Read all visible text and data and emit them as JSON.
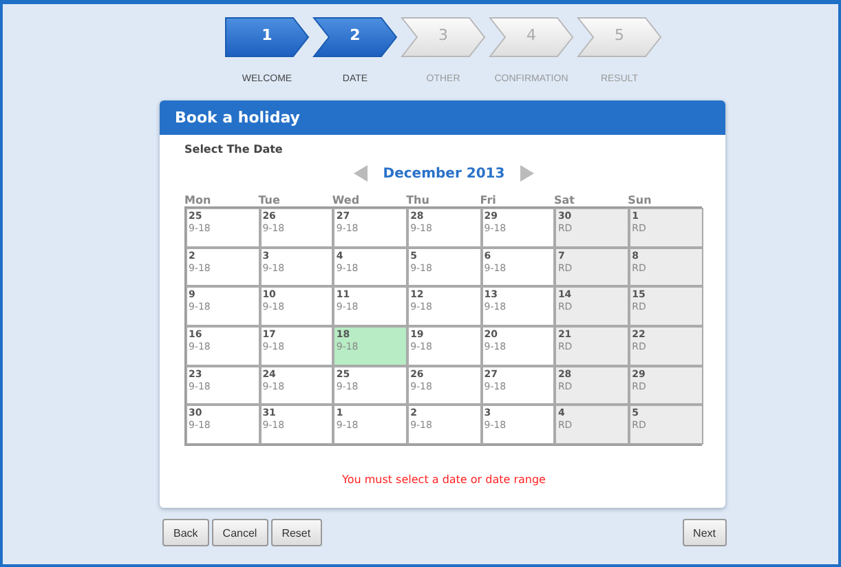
{
  "steps": [
    {
      "number": "1",
      "label": "WELCOME",
      "active": true
    },
    {
      "number": "2",
      "label": "DATE",
      "active": true
    },
    {
      "number": "3",
      "label": "OTHER",
      "active": false
    },
    {
      "number": "4",
      "label": "CONFIRMATION",
      "active": false
    },
    {
      "number": "5",
      "label": "RESULT",
      "active": false
    }
  ],
  "panel": {
    "title": "Book a holiday",
    "subtitle": "Select The Date"
  },
  "calendar": {
    "month": "December 2013",
    "weekdays": [
      "Mon",
      "Tue",
      "Wed",
      "Thu",
      "Fri",
      "Sat",
      "Sun"
    ],
    "weeks": [
      [
        {
          "day": "25",
          "hours": "9-18",
          "weekend": false,
          "selected": false
        },
        {
          "day": "26",
          "hours": "9-18",
          "weekend": false,
          "selected": false
        },
        {
          "day": "27",
          "hours": "9-18",
          "weekend": false,
          "selected": false
        },
        {
          "day": "28",
          "hours": "9-18",
          "weekend": false,
          "selected": false
        },
        {
          "day": "29",
          "hours": "9-18",
          "weekend": false,
          "selected": false
        },
        {
          "day": "30",
          "hours": "RD",
          "weekend": true,
          "selected": false
        },
        {
          "day": "1",
          "hours": "RD",
          "weekend": true,
          "selected": false
        }
      ],
      [
        {
          "day": "2",
          "hours": "9-18",
          "weekend": false,
          "selected": false
        },
        {
          "day": "3",
          "hours": "9-18",
          "weekend": false,
          "selected": false
        },
        {
          "day": "4",
          "hours": "9-18",
          "weekend": false,
          "selected": false
        },
        {
          "day": "5",
          "hours": "9-18",
          "weekend": false,
          "selected": false
        },
        {
          "day": "6",
          "hours": "9-18",
          "weekend": false,
          "selected": false
        },
        {
          "day": "7",
          "hours": "RD",
          "weekend": true,
          "selected": false
        },
        {
          "day": "8",
          "hours": "RD",
          "weekend": true,
          "selected": false
        }
      ],
      [
        {
          "day": "9",
          "hours": "9-18",
          "weekend": false,
          "selected": false
        },
        {
          "day": "10",
          "hours": "9-18",
          "weekend": false,
          "selected": false
        },
        {
          "day": "11",
          "hours": "9-18",
          "weekend": false,
          "selected": false
        },
        {
          "day": "12",
          "hours": "9-18",
          "weekend": false,
          "selected": false
        },
        {
          "day": "13",
          "hours": "9-18",
          "weekend": false,
          "selected": false
        },
        {
          "day": "14",
          "hours": "RD",
          "weekend": true,
          "selected": false
        },
        {
          "day": "15",
          "hours": "RD",
          "weekend": true,
          "selected": false
        }
      ],
      [
        {
          "day": "16",
          "hours": "9-18",
          "weekend": false,
          "selected": false
        },
        {
          "day": "17",
          "hours": "9-18",
          "weekend": false,
          "selected": false
        },
        {
          "day": "18",
          "hours": "9-18",
          "weekend": false,
          "selected": true
        },
        {
          "day": "19",
          "hours": "9-18",
          "weekend": false,
          "selected": false
        },
        {
          "day": "20",
          "hours": "9-18",
          "weekend": false,
          "selected": false
        },
        {
          "day": "21",
          "hours": "RD",
          "weekend": true,
          "selected": false
        },
        {
          "day": "22",
          "hours": "RD",
          "weekend": true,
          "selected": false
        }
      ],
      [
        {
          "day": "23",
          "hours": "9-18",
          "weekend": false,
          "selected": false
        },
        {
          "day": "24",
          "hours": "9-18",
          "weekend": false,
          "selected": false
        },
        {
          "day": "25",
          "hours": "9-18",
          "weekend": false,
          "selected": false
        },
        {
          "day": "26",
          "hours": "9-18",
          "weekend": false,
          "selected": false
        },
        {
          "day": "27",
          "hours": "9-18",
          "weekend": false,
          "selected": false
        },
        {
          "day": "28",
          "hours": "RD",
          "weekend": true,
          "selected": false
        },
        {
          "day": "29",
          "hours": "RD",
          "weekend": true,
          "selected": false
        }
      ],
      [
        {
          "day": "30",
          "hours": "9-18",
          "weekend": false,
          "selected": false
        },
        {
          "day": "31",
          "hours": "9-18",
          "weekend": false,
          "selected": false
        },
        {
          "day": "1",
          "hours": "9-18",
          "weekend": false,
          "selected": false
        },
        {
          "day": "2",
          "hours": "9-18",
          "weekend": false,
          "selected": false
        },
        {
          "day": "3",
          "hours": "9-18",
          "weekend": false,
          "selected": false
        },
        {
          "day": "4",
          "hours": "RD",
          "weekend": true,
          "selected": false
        },
        {
          "day": "5",
          "hours": "RD",
          "weekend": true,
          "selected": false
        }
      ]
    ]
  },
  "error": "You must select a date or date range",
  "buttons_left": [
    "Back",
    "Cancel",
    "Reset"
  ],
  "buttons_right": [
    "Next"
  ]
}
